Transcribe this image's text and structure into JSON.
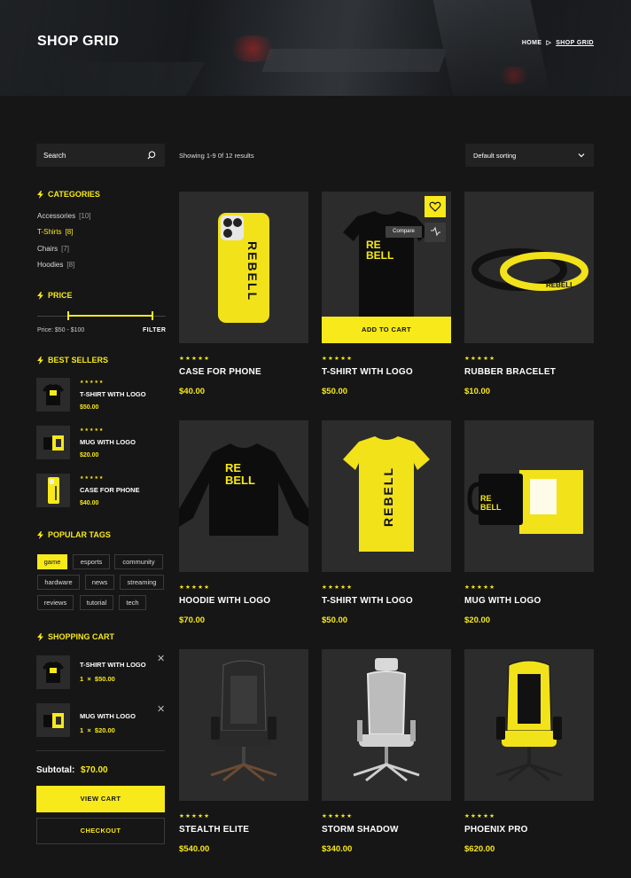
{
  "hero": {
    "title": "SHOP GRID",
    "breadcrumb": {
      "home": "HOME",
      "current": "SHOP GRID"
    }
  },
  "search": {
    "placeholder": "Search"
  },
  "toolbar": {
    "results_text": "Showing 1-9 0f 12 results",
    "sort_selected": "Default sorting"
  },
  "categories": {
    "title": "CATEGORIES",
    "items": [
      {
        "name": "Accessories",
        "count": "[10]"
      },
      {
        "name": "T-Shirts",
        "count": "[8]"
      },
      {
        "name": "Chairs",
        "count": "[7]"
      },
      {
        "name": "Hoodies",
        "count": "[8]"
      }
    ]
  },
  "price": {
    "title": "PRICE",
    "label": "Price: $50 - $100",
    "filter": "FILTER",
    "min": 50,
    "max": 100
  },
  "best_sellers": {
    "title": "BEST SELLERS",
    "items": [
      {
        "name": "T-SHIRT WITH LOGO",
        "price": "$50.00",
        "stars": "★★★★★"
      },
      {
        "name": "MUG WITH LOGO",
        "price": "$20.00",
        "stars": "★★★★★"
      },
      {
        "name": "CASE FOR PHONE",
        "price": "$40.00",
        "stars": "★★★★★"
      }
    ]
  },
  "tags": {
    "title": "POPULAR TAGS",
    "items": [
      "game",
      "esports",
      "community",
      "hardware",
      "news",
      "streaming",
      "reviews",
      "tutorial",
      "tech"
    ]
  },
  "cart": {
    "title": "SHOPPING CART",
    "items": [
      {
        "name": "T-SHIRT WITH LOGO",
        "qty": "1",
        "times": "×",
        "price": "$50.00"
      },
      {
        "name": "MUG WITH LOGO",
        "qty": "1",
        "times": "×",
        "price": "$20.00"
      }
    ],
    "subtotal_label": "Subtotal:",
    "subtotal_value": "$70.00",
    "view_cart": "VIEW CART",
    "checkout": "CHECKOUT"
  },
  "product_actions": {
    "compare_tooltip": "Compare",
    "add_to_cart": "ADD TO CART"
  },
  "products": [
    {
      "name": "CASE FOR PHONE",
      "price": "$40.00",
      "stars": "★★★★★"
    },
    {
      "name": "T-SHIRT WITH LOGO",
      "price": "$50.00",
      "stars": "★★★★★"
    },
    {
      "name": "RUBBER BRACELET",
      "price": "$10.00",
      "stars": "★★★★★"
    },
    {
      "name": "HOODIE WITH LOGO",
      "price": "$70.00",
      "stars": "★★★★★"
    },
    {
      "name": "T-SHIRT WITH LOGO",
      "price": "$50.00",
      "stars": "★★★★★"
    },
    {
      "name": "MUG WITH LOGO",
      "price": "$20.00",
      "stars": "★★★★★"
    },
    {
      "name": "STEALTH ELITE",
      "price": "$540.00",
      "stars": "★★★★★"
    },
    {
      "name": "STORM SHADOW",
      "price": "$340.00",
      "stars": "★★★★★"
    },
    {
      "name": "PHOENIX PRO",
      "price": "$620.00",
      "stars": "★★★★★"
    }
  ],
  "brand_mark": "REBELL",
  "colors": {
    "accent": "#f7e91a",
    "background": "#161616",
    "panel": "#222222",
    "card": "#2c2c2c"
  }
}
